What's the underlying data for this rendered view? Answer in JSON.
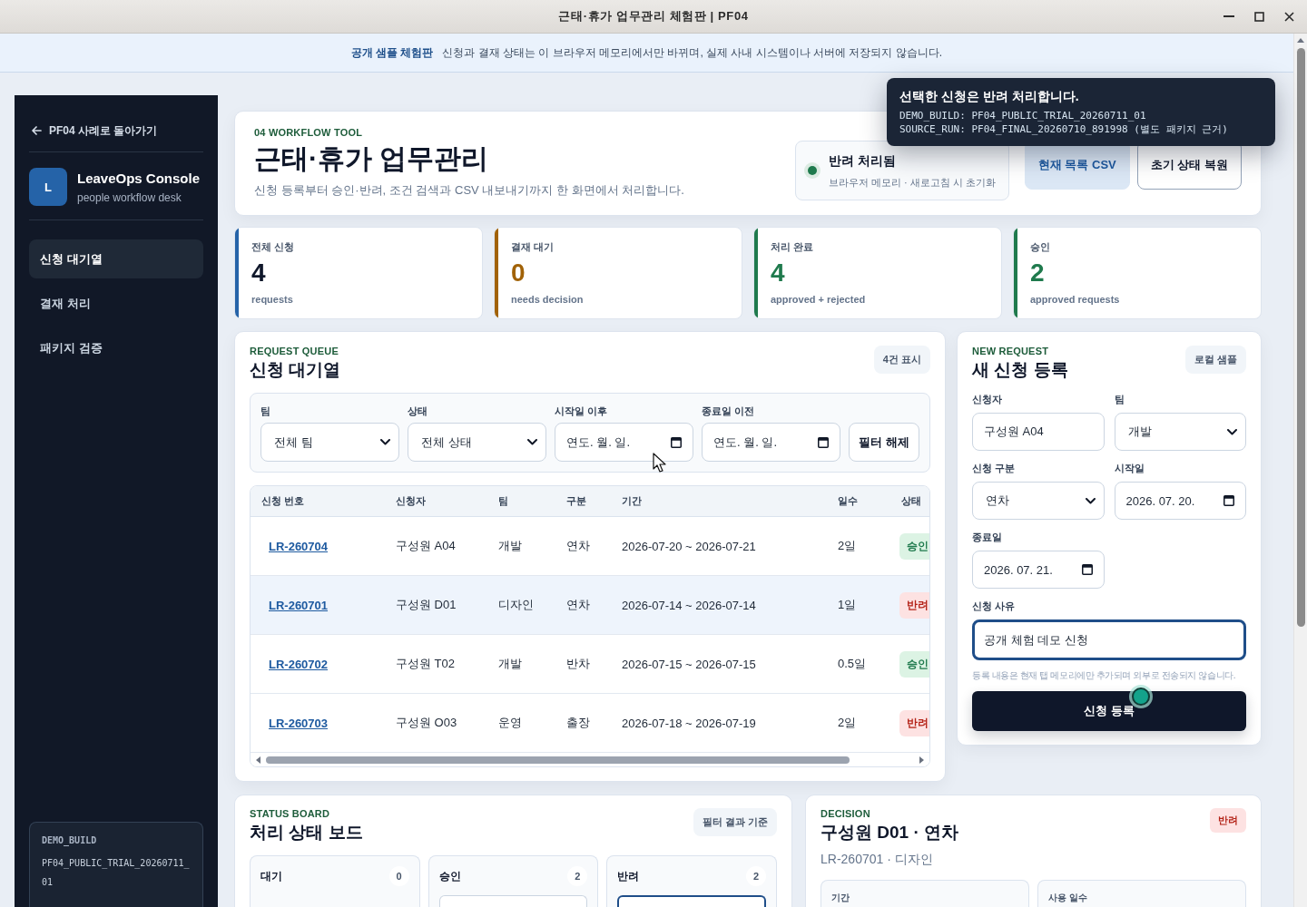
{
  "title_bar": {
    "title": "근태·휴가 업무관리 체험판 | PF04"
  },
  "banner": {
    "label": "공개 샘플 체험판",
    "text": "신청과 결재 상태는 이 브라우저 메모리에서만 바뀌며, 실제 사내 시스템이나 서버에 저장되지 않습니다."
  },
  "sidebar": {
    "back_link": "PF04 사례로 돌아가기",
    "brand": {
      "initial": "L",
      "name": "LeaveOps Console",
      "tagline": "people workflow desk"
    },
    "items": [
      {
        "label": "신청 대기열",
        "selected": true
      },
      {
        "label": "결재 처리",
        "selected": false
      },
      {
        "label": "패키지 검증",
        "selected": false
      }
    ],
    "build_info": {
      "label": "DEMO_BUILD",
      "value": "PF04_PUBLIC_TRIAL_20260711_01"
    }
  },
  "header": {
    "eyebrow": "04 WORKFLOW TOOL",
    "title": "근태·휴가 업무관리",
    "subtitle": "신청 등록부터 승인·반려, 조건 검색과 CSV 내보내기까지 한 화면에서 처리합니다.",
    "status": {
      "title": "반려 처리됨",
      "detail": "브라우저 메모리 · 새로고침 시 초기화"
    },
    "buttons": [
      {
        "label": "현재 목록 CSV",
        "kind": "primary"
      },
      {
        "label": "초기 상태 복원",
        "kind": "secondary"
      }
    ]
  },
  "stats": [
    {
      "label": "전체 신청",
      "value": "4",
      "caption": "requests",
      "color": "#2563a8",
      "highlight": false
    },
    {
      "label": "결재 대기",
      "value": "0",
      "caption": "needs decision",
      "color": "#a16207",
      "highlight": true
    },
    {
      "label": "처리 완료",
      "value": "4",
      "caption": "approved + rejected",
      "color": "#1f7a4d",
      "highlight": true
    },
    {
      "label": "승인",
      "value": "2",
      "caption": "approved requests",
      "color": "#1f7a4d",
      "highlight": true
    }
  ],
  "queue": {
    "eyebrow": "REQUEST QUEUE",
    "title": "신청 대기열",
    "count": "4건 표시",
    "filters": [
      {
        "label": "팀",
        "kind": "select",
        "value": "전체 팀"
      },
      {
        "label": "상태",
        "kind": "select",
        "value": "전체 상태"
      },
      {
        "label": "시작일 이후",
        "kind": "date",
        "placeholder": "연도. 월. 일."
      },
      {
        "label": "종료일 이전",
        "kind": "date",
        "placeholder": "연도. 월. 일."
      }
    ],
    "clear_button": "필터 해제",
    "columns": [
      "신청 번호",
      "신청자",
      "팀",
      "구분",
      "기간",
      "일수",
      "상태"
    ],
    "rows": [
      {
        "id": "LR-260704",
        "applicant": "구성원 A04",
        "team": "개발",
        "type": "연차",
        "period": "2026-07-20 ~ 2026-07-21",
        "days": "2일",
        "status": {
          "text": "승인",
          "kind": "approved"
        },
        "selected": false
      },
      {
        "id": "LR-260701",
        "applicant": "구성원 D01",
        "team": "디자인",
        "type": "연차",
        "period": "2026-07-14 ~ 2026-07-14",
        "days": "1일",
        "status": {
          "text": "반려",
          "kind": "rejected"
        },
        "selected": true
      },
      {
        "id": "LR-260702",
        "applicant": "구성원 T02",
        "team": "개발",
        "type": "반차",
        "period": "2026-07-15 ~ 2026-07-15",
        "days": "0.5일",
        "status": {
          "text": "승인",
          "kind": "approved"
        },
        "selected": false
      },
      {
        "id": "LR-260703",
        "applicant": "구성원 O03",
        "team": "운영",
        "type": "출장",
        "period": "2026-07-18 ~ 2026-07-19",
        "days": "2일",
        "status": {
          "text": "반려",
          "kind": "rejected"
        },
        "selected": false
      }
    ]
  },
  "new_request": {
    "eyebrow": "NEW REQUEST",
    "title": "새 신청 등록",
    "badge": "로컬 샘플",
    "fields": [
      {
        "label": "신청자",
        "kind": "text",
        "value": "구성원 A04",
        "focused": false
      },
      {
        "label": "팀",
        "kind": "select",
        "value": "개발",
        "focused": false
      },
      {
        "label": "신청 구분",
        "kind": "select",
        "value": "연차",
        "focused": false
      },
      {
        "label": "시작일",
        "kind": "date",
        "value": "2026. 07. 20.",
        "focused": false
      },
      {
        "label": "종료일",
        "kind": "date",
        "value": "2026. 07. 21.",
        "focused": false
      },
      {
        "label": "신청 사유",
        "kind": "textarea",
        "value": "공개 체험 데모 신청",
        "focused": true
      }
    ],
    "hint": "등록 내용은 현재 탭 메모리에만 추가되며 외부로 전송되지 않습니다.",
    "submit": "신청 등록"
  },
  "status_board": {
    "eyebrow": "STATUS BOARD",
    "title": "처리 상태 보드",
    "badge": "필터 결과 기준",
    "lanes": [
      {
        "title": "대기",
        "count": "0"
      },
      {
        "title": "승인",
        "count": "2",
        "cards": [
          {
            "selected": false
          }
        ]
      },
      {
        "title": "반려",
        "count": "2",
        "cards": [
          {
            "selected": true
          }
        ]
      }
    ]
  },
  "decision": {
    "eyebrow": "DECISION",
    "title": "구성원 D01 · 연차",
    "subtitle": "LR-260701 · 디자인",
    "badge": {
      "text": "반려",
      "kind": "rejected"
    },
    "fields": [
      {
        "label": "기간"
      },
      {
        "label": "사용 일수"
      }
    ]
  },
  "tooltip": {
    "title": "선택한 신청은 반려 처리합니다.",
    "lines": [
      "DEMO_BUILD: PF04_PUBLIC_TRIAL_20260711_01",
      "SOURCE_RUN: PF04_FINAL_20260710_891998 (별도 패키지 근거)"
    ]
  }
}
